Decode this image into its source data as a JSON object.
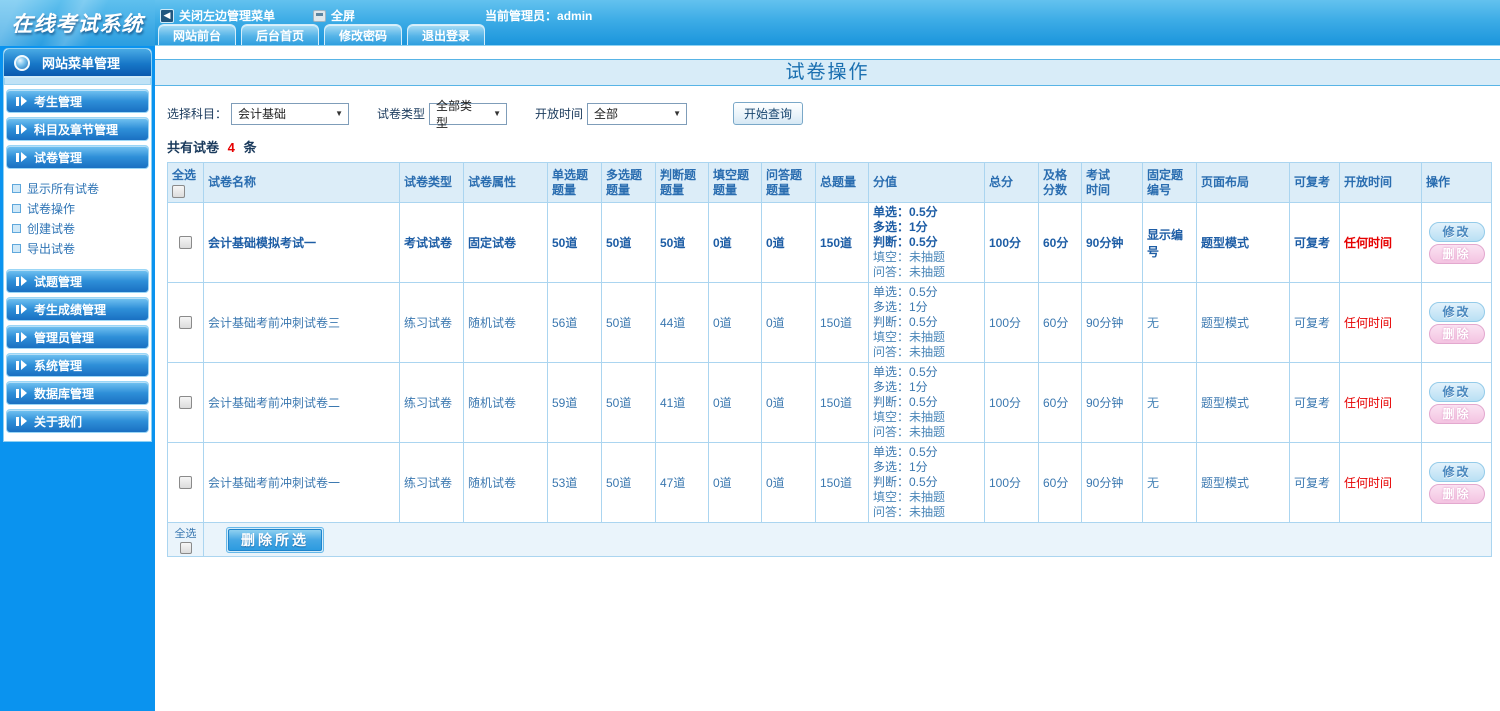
{
  "colors": {
    "accent_blue": "#0a93ef",
    "header_text": "#2a6db0",
    "alert_red": "#e60000"
  },
  "header": {
    "logo": "在线考试系统",
    "close_menu_label": "关闭左边管理菜单",
    "fullscreen_label": "全屏",
    "admin_label": "当前管理员：admin",
    "tabs": [
      "网站前台",
      "后台首页",
      "修改密码",
      "退出登录"
    ]
  },
  "sidebar": {
    "title": "网站菜单管理",
    "groups_top": [
      "考生管理",
      "科目及章节管理",
      "试卷管理"
    ],
    "submenu": [
      "显示所有试卷",
      "试卷操作",
      "创建试卷",
      "导出试卷"
    ],
    "groups_bottom": [
      "试题管理",
      "考生成绩管理",
      "管理员管理",
      "系统管理",
      "数据库管理",
      "关于我们"
    ]
  },
  "main": {
    "title": "试卷操作",
    "filters": {
      "subject_label": "选择科目：",
      "subject_value": "会计基础",
      "type_label": "试卷类型",
      "type_value": "全部类型",
      "open_label": "开放时间",
      "open_value": "全部",
      "query_button": "开始查询"
    },
    "count": {
      "prefix": "共有试卷",
      "number": "4",
      "suffix": "条"
    }
  },
  "table": {
    "columns": [
      "全选",
      "试卷名称",
      "试卷类型",
      "试卷属性",
      "单选题\n题量",
      "多选题\n题量",
      "判断题\n题量",
      "填空题\n题量",
      "问答题\n题量",
      "总题量",
      "分值",
      "总分",
      "及格\n分数",
      "考试\n时间",
      "固定题\n编号",
      "页面布局",
      "可复考",
      "开放时间",
      "操作"
    ],
    "rows": [
      {
        "bold": true,
        "name": "会计基础模拟考试一",
        "type": "考试试卷",
        "attr": "固定试卷",
        "single": "50道",
        "multi": "50道",
        "judge": "50道",
        "blank": "0道",
        "qa": "0道",
        "total": "150道",
        "score_lines": [
          "单选：0.5分",
          "多选：1分",
          "判断：0.5分",
          "填空：未抽题",
          "问答：未抽题"
        ],
        "total_score": "100分",
        "pass_score": "60分",
        "exam_time": "90分钟",
        "fixed_num": "显示编号",
        "layout": "题型模式",
        "retake": "可复考",
        "open_time": "任何时间"
      },
      {
        "bold": false,
        "name": "会计基础考前冲刺试卷三",
        "type": "练习试卷",
        "attr": "随机试卷",
        "single": "56道",
        "multi": "50道",
        "judge": "44道",
        "blank": "0道",
        "qa": "0道",
        "total": "150道",
        "score_lines": [
          "单选：0.5分",
          "多选：1分",
          "判断：0.5分",
          "填空：未抽题",
          "问答：未抽题"
        ],
        "total_score": "100分",
        "pass_score": "60分",
        "exam_time": "90分钟",
        "fixed_num": "无",
        "layout": "题型模式",
        "retake": "可复考",
        "open_time": "任何时间"
      },
      {
        "bold": false,
        "name": "会计基础考前冲刺试卷二",
        "type": "练习试卷",
        "attr": "随机试卷",
        "single": "59道",
        "multi": "50道",
        "judge": "41道",
        "blank": "0道",
        "qa": "0道",
        "total": "150道",
        "score_lines": [
          "单选：0.5分",
          "多选：1分",
          "判断：0.5分",
          "填空：未抽题",
          "问答：未抽题"
        ],
        "total_score": "100分",
        "pass_score": "60分",
        "exam_time": "90分钟",
        "fixed_num": "无",
        "layout": "题型模式",
        "retake": "可复考",
        "open_time": "任何时间"
      },
      {
        "bold": false,
        "name": "会计基础考前冲刺试卷一",
        "type": "练习试卷",
        "attr": "随机试卷",
        "single": "53道",
        "multi": "50道",
        "judge": "47道",
        "blank": "0道",
        "qa": "0道",
        "total": "150道",
        "score_lines": [
          "单选：0.5分",
          "多选：1分",
          "判断：0.5分",
          "填空：未抽题",
          "问答：未抽题"
        ],
        "total_score": "100分",
        "pass_score": "60分",
        "exam_time": "90分钟",
        "fixed_num": "无",
        "layout": "题型模式",
        "retake": "可复考",
        "open_time": "任何时间"
      }
    ],
    "actions": {
      "edit": "修改",
      "delete": "删除"
    },
    "footer": {
      "select_all": "全选",
      "delete_selected": "删除所选"
    }
  }
}
